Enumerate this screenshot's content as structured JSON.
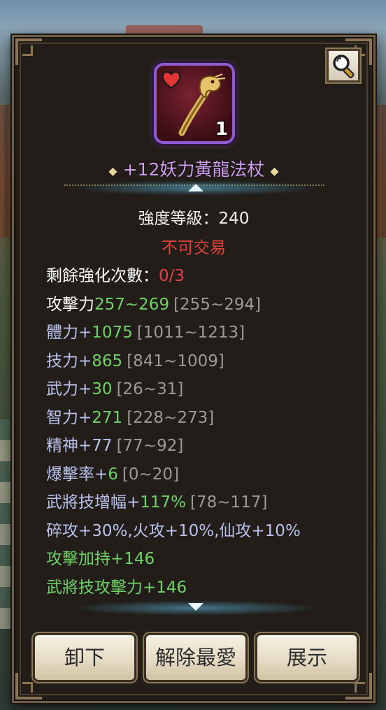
{
  "item": {
    "name": "+12妖力黃龍法杖",
    "quantity": "1",
    "strength": "強度等級：240",
    "trade_status": "不可交易",
    "rarity_color": "#8d5ad0",
    "icons": [
      "heart-icon",
      "dragon-staff-icon",
      "magnifier-icon"
    ]
  },
  "stats": [
    {
      "label": "剩餘強化次數：",
      "value": "0/3",
      "range": "",
      "label_color": "#ffffff",
      "value_color": "#e6404a"
    },
    {
      "label": "攻擊力",
      "value": "257~269",
      "range": "[255~294]",
      "label_color": "#ffffff",
      "value_color": "#6ed267"
    },
    {
      "label": "體力+",
      "value": "1075",
      "range": "[1011~1213]",
      "label_color": "#b9c1ec",
      "value_color": "#6ed267"
    },
    {
      "label": "技力+",
      "value": "865",
      "range": "[841~1009]",
      "label_color": "#b9c1ec",
      "value_color": "#6ed267"
    },
    {
      "label": "武力+",
      "value": "30",
      "range": "[26~31]",
      "label_color": "#b9c1ec",
      "value_color": "#6ed267"
    },
    {
      "label": "智力+",
      "value": "271",
      "range": "[228~273]",
      "label_color": "#b9c1ec",
      "value_color": "#6ed267"
    },
    {
      "label": "精神+",
      "value": "77",
      "range": "[77~92]",
      "label_color": "#b9c1ec",
      "value_color": "#b9c1ec"
    },
    {
      "label": "爆擊率+",
      "value": "6",
      "range": "[0~20]",
      "label_color": "#b9c1ec",
      "value_color": "#6ed267"
    },
    {
      "label": "武將技增幅+",
      "value": "117%",
      "range": "[78~117]",
      "label_color": "#b9c1ec",
      "value_color": "#6ed267"
    },
    {
      "label": "碎攻+30%,火攻+10%,仙攻+10%",
      "value": "",
      "range": "",
      "label_color": "#b9c1ec",
      "value_color": "#b9c1ec"
    },
    {
      "label": "攻擊加持+146",
      "value": "",
      "range": "",
      "label_color": "#6ed267",
      "value_color": "#6ed267"
    },
    {
      "label": "武將技攻擊力+146",
      "value": "",
      "range": "",
      "label_color": "#6ed267",
      "value_color": "#6ed267"
    }
  ],
  "buttons": {
    "unequip": "卸下",
    "unfavorite": "解除最愛",
    "show": "展示"
  }
}
